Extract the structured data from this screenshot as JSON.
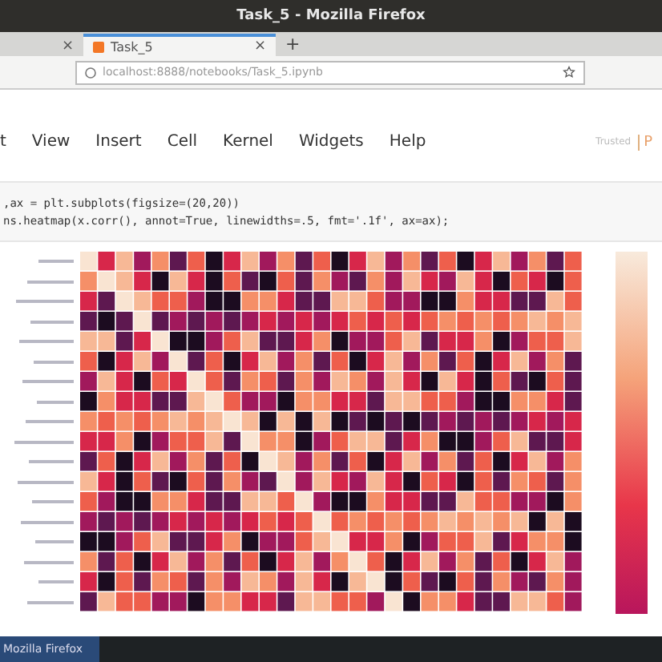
{
  "window": {
    "title": "Task_5 - Mozilla Firefox"
  },
  "tabs": [
    {
      "selected": false,
      "close": "×"
    },
    {
      "label": "Task_5",
      "selected": true,
      "close": "×"
    }
  ],
  "new_tab": "+",
  "address_bar": {
    "url": "localhost:8888/notebooks/Task_5.ipynb"
  },
  "menu": [
    "t",
    "View",
    "Insert",
    "Cell",
    "Kernel",
    "Widgets",
    "Help"
  ],
  "notebook_status": {
    "trust": "Trusted",
    "kernel_initial": "P"
  },
  "code_lines": [
    ",ax = plt.subplots(figsize=(20,20))",
    "ns.heatmap(x.corr(), annot=True, linewidths=.5, fmt='.1f', ax=ax);"
  ],
  "taskbar": {
    "item": "Mozilla Firefox"
  }
}
